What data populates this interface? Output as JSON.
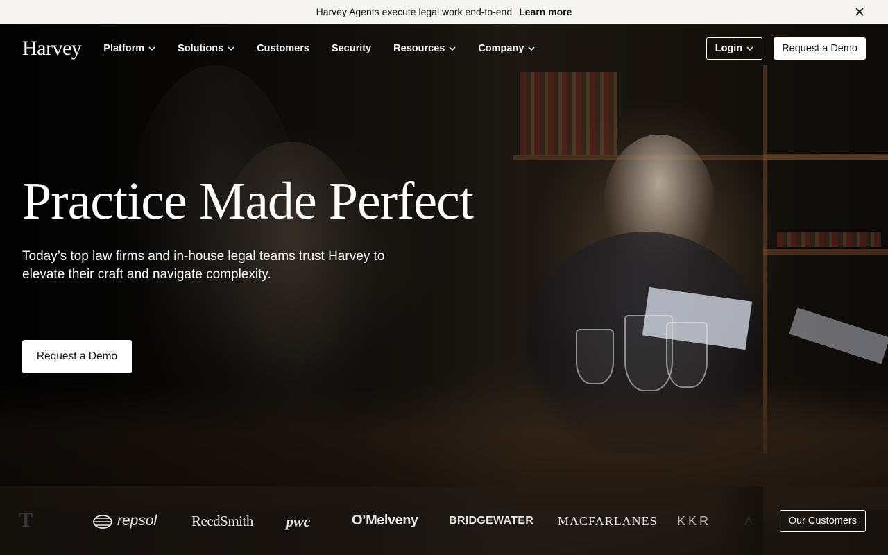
{
  "announcement": {
    "text": "Harvey Agents execute legal work end-to-end",
    "link": "Learn more"
  },
  "nav": {
    "logo": "Harvey",
    "items": [
      {
        "label": "Platform",
        "has_dropdown": true
      },
      {
        "label": "Solutions",
        "has_dropdown": true
      },
      {
        "label": "Customers",
        "has_dropdown": false
      },
      {
        "label": "Security",
        "has_dropdown": false
      },
      {
        "label": "Resources",
        "has_dropdown": true
      },
      {
        "label": "Company",
        "has_dropdown": true
      }
    ],
    "login": "Login",
    "request_demo": "Request a Demo"
  },
  "hero": {
    "title": "Practice Made Perfect",
    "subtitle": "Today’s top law firms and in-house legal teams trust Harvey to elevate their craft and navigate complexity.",
    "cta": "Request a Demo"
  },
  "clients": {
    "logos": [
      "T",
      "repsol",
      "ReedSmith",
      "pwc",
      "O’Melveny",
      "BRIDGEWATER",
      "MACFARLANES",
      "KKR",
      "A"
    ],
    "button": "Our Customers"
  },
  "colors": {
    "announcement_bg": "#f6f5f1",
    "text_light": "#ffffff",
    "button_bg": "#ffffff",
    "button_text": "#111111"
  }
}
